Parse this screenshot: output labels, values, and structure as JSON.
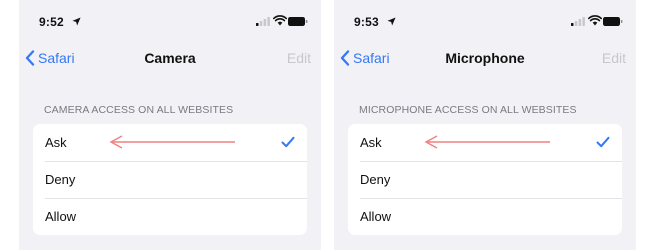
{
  "screens": [
    {
      "status": {
        "time": "9:52"
      },
      "nav": {
        "back_label": "Safari",
        "title": "Camera",
        "edit_label": "Edit"
      },
      "section_header": "CAMERA ACCESS ON ALL WEBSITES",
      "options": [
        "Ask",
        "Deny",
        "Allow"
      ],
      "selected": "Ask"
    },
    {
      "status": {
        "time": "9:53"
      },
      "nav": {
        "back_label": "Safari",
        "title": "Microphone",
        "edit_label": "Edit"
      },
      "section_header": "MICROPHONE ACCESS ON ALL WEBSITES",
      "options": [
        "Ask",
        "Deny",
        "Allow"
      ],
      "selected": "Ask"
    }
  ],
  "colors": {
    "accent": "#3478f6",
    "annotation_arrow": "#f08080",
    "background": "#f1f1f6"
  },
  "icons": [
    "location-arrow-icon",
    "cellular-signal-icon",
    "wifi-icon",
    "battery-icon",
    "chevron-left-icon",
    "checkmark-icon",
    "annotation-arrow-icon"
  ]
}
